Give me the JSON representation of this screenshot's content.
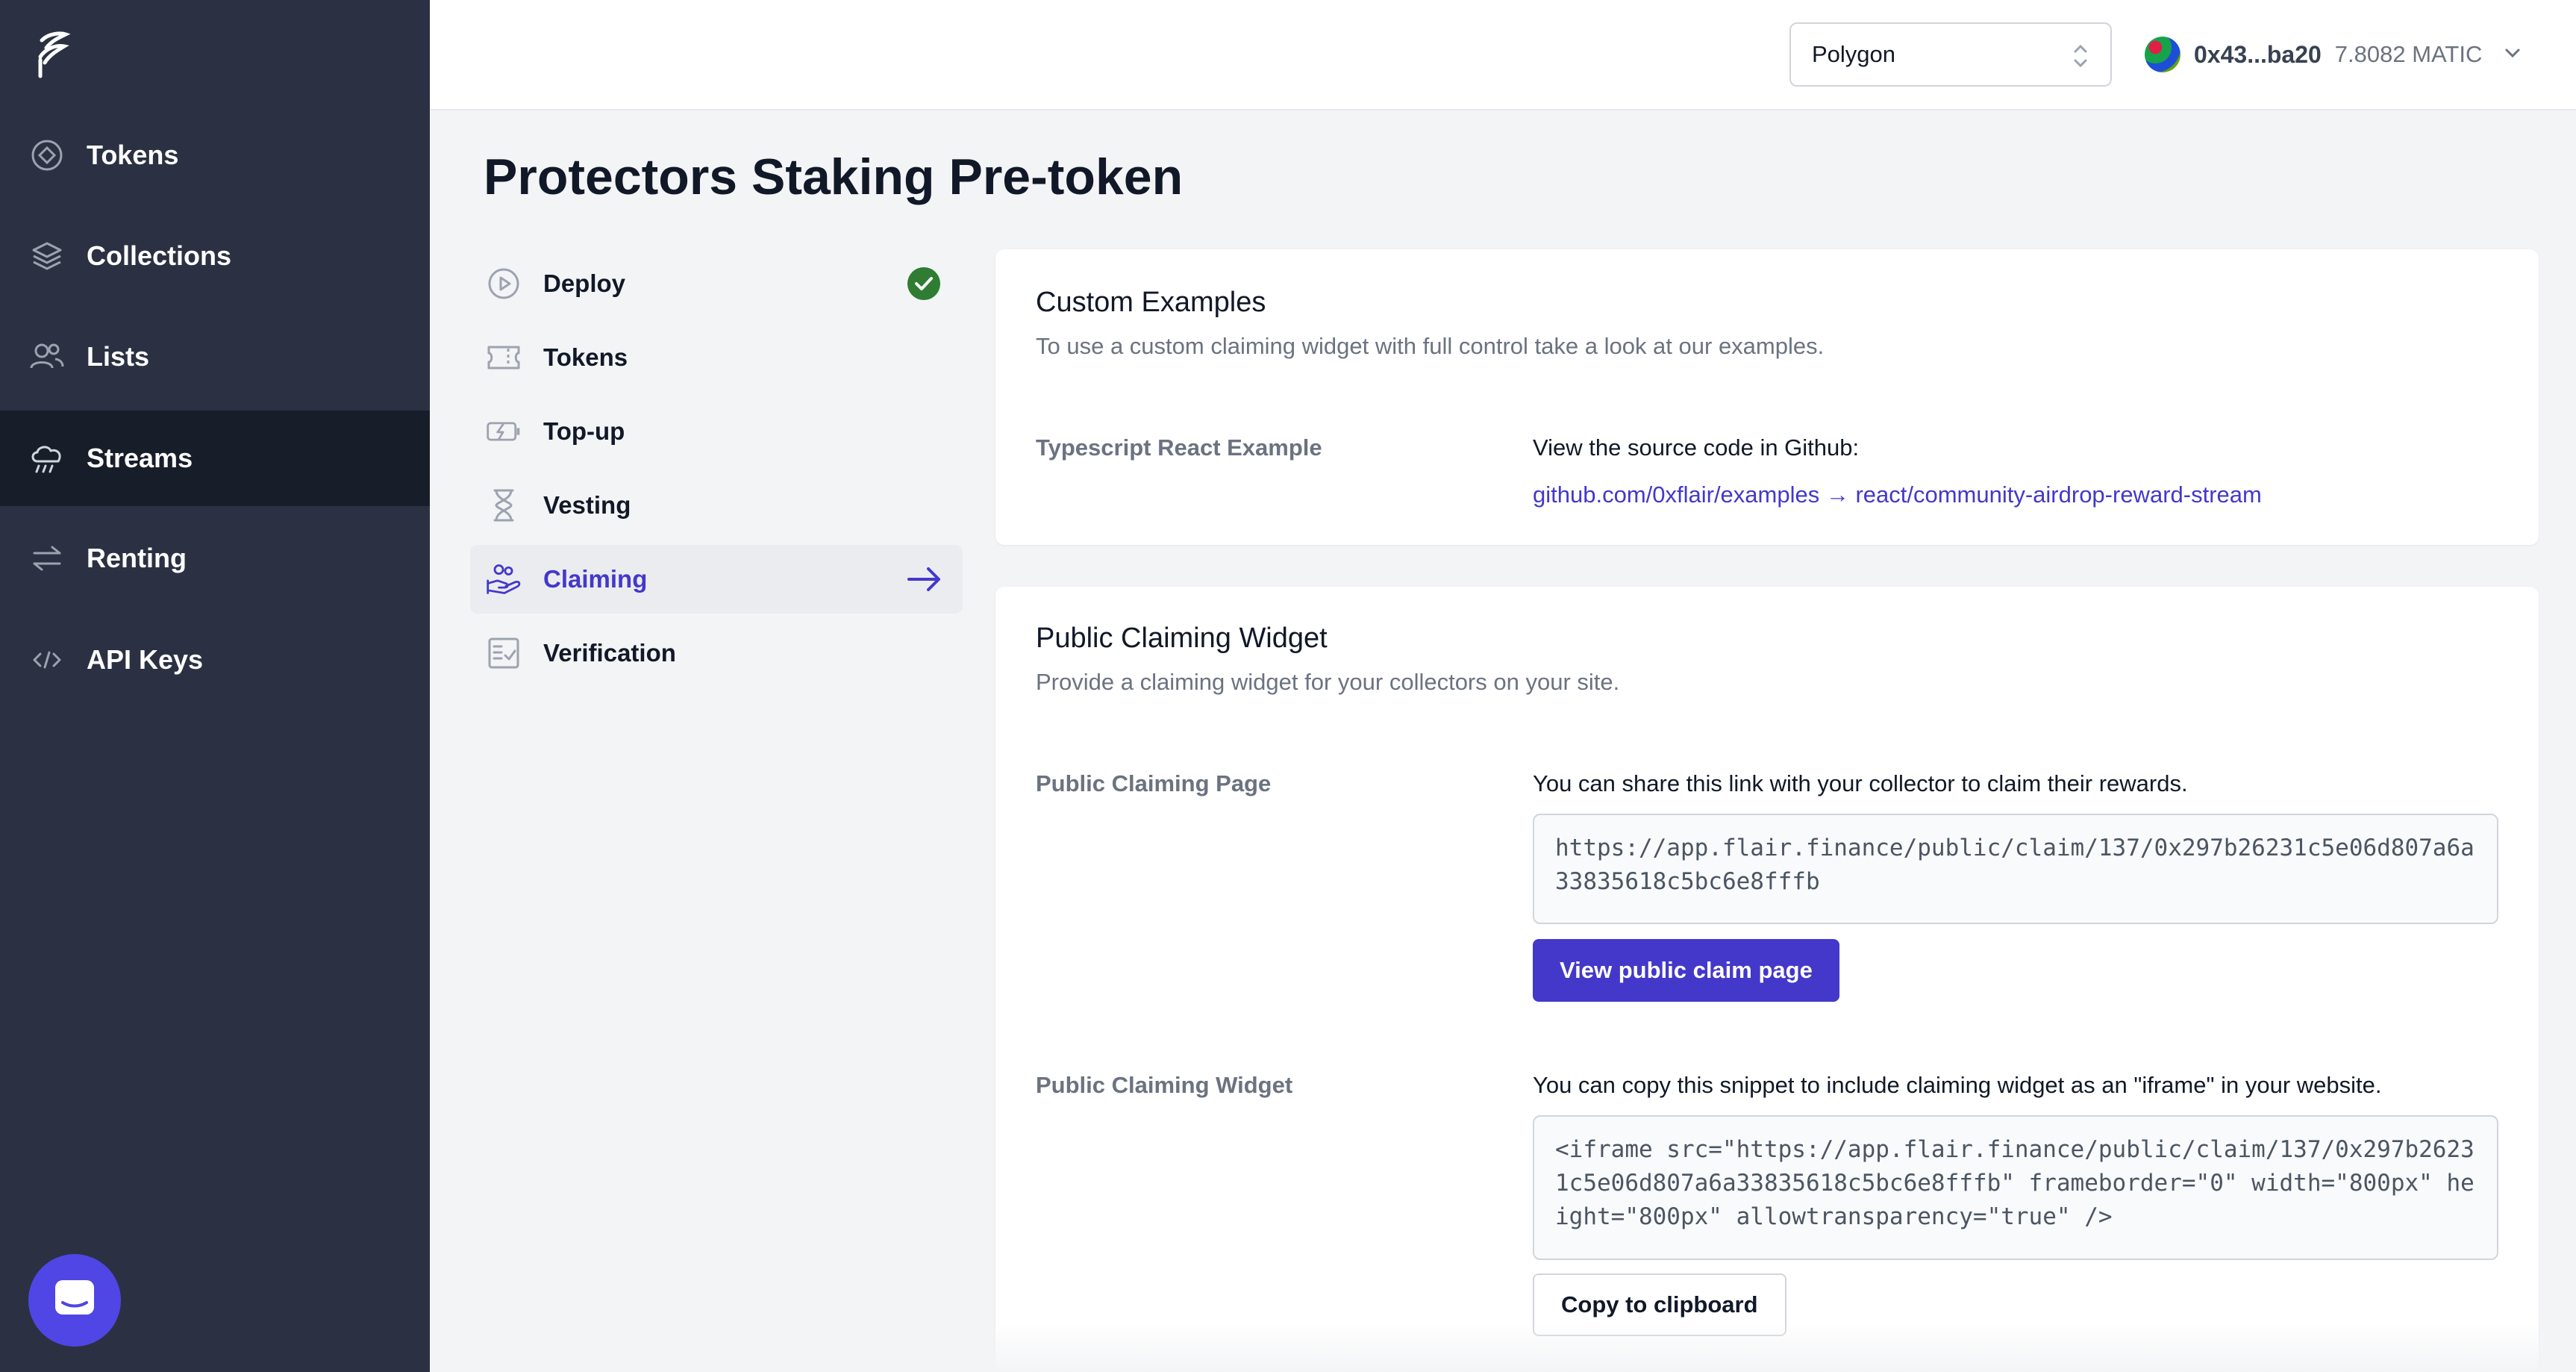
{
  "sidebar": {
    "items": [
      {
        "label": "Tokens",
        "icon": "token-diamond-icon"
      },
      {
        "label": "Collections",
        "icon": "layers-icon"
      },
      {
        "label": "Lists",
        "icon": "users-icon"
      },
      {
        "label": "Streams",
        "icon": "cloud-rain-icon",
        "active": true
      },
      {
        "label": "Renting",
        "icon": "switch-arrows-icon"
      },
      {
        "label": "API Keys",
        "icon": "code-icon"
      }
    ]
  },
  "header": {
    "network": "Polygon",
    "address": "0x43...ba20",
    "balance": "7.8082 MATIC"
  },
  "page": {
    "title": "Protectors Staking Pre-token"
  },
  "steps": [
    {
      "label": "Deploy",
      "icon": "play-circle-icon",
      "done": true
    },
    {
      "label": "Tokens",
      "icon": "ticket-icon"
    },
    {
      "label": "Top-up",
      "icon": "battery-charge-icon"
    },
    {
      "label": "Vesting",
      "icon": "hourglass-icon"
    },
    {
      "label": "Claiming",
      "icon": "hand-coins-icon",
      "active": true
    },
    {
      "label": "Verification",
      "icon": "checklist-icon"
    }
  ],
  "custom_examples": {
    "title": "Custom Examples",
    "subtitle": "To use a custom claiming widget with full control take a look at our examples.",
    "row_label": "Typescript React Example",
    "row_text": "View the source code in Github:",
    "link": "github.com/0xflair/examples → react/community-airdrop-reward-stream"
  },
  "public_widget": {
    "title": "Public Claiming Widget",
    "subtitle": "Provide a claiming widget for your collectors on your site.",
    "page_label": "Public Claiming Page",
    "page_text": "You can share this link with your collector to claim their rewards.",
    "page_url": "https://app.flair.finance/public/claim/137/0x297b26231c5e06d807a6a33835618c5bc6e8fffb",
    "view_button": "View public claim page",
    "widget_label": "Public Claiming Widget",
    "widget_text": "You can copy this snippet to include claiming widget as an \"iframe\" in your website.",
    "snippet": "<iframe src=\"https://app.flair.finance/public/claim/137/0x297b26231c5e06d807a6a33835618c5bc6e8fffb\" frameborder=\"0\" width=\"800px\" height=\"800px\" allowtransparency=\"true\" />",
    "copy_button": "Copy to clipboard"
  },
  "colors": {
    "sidebar_bg": "#2b3142",
    "sidebar_active": "#181d2a",
    "accent": "#4338ca",
    "success": "#2e7d32"
  }
}
